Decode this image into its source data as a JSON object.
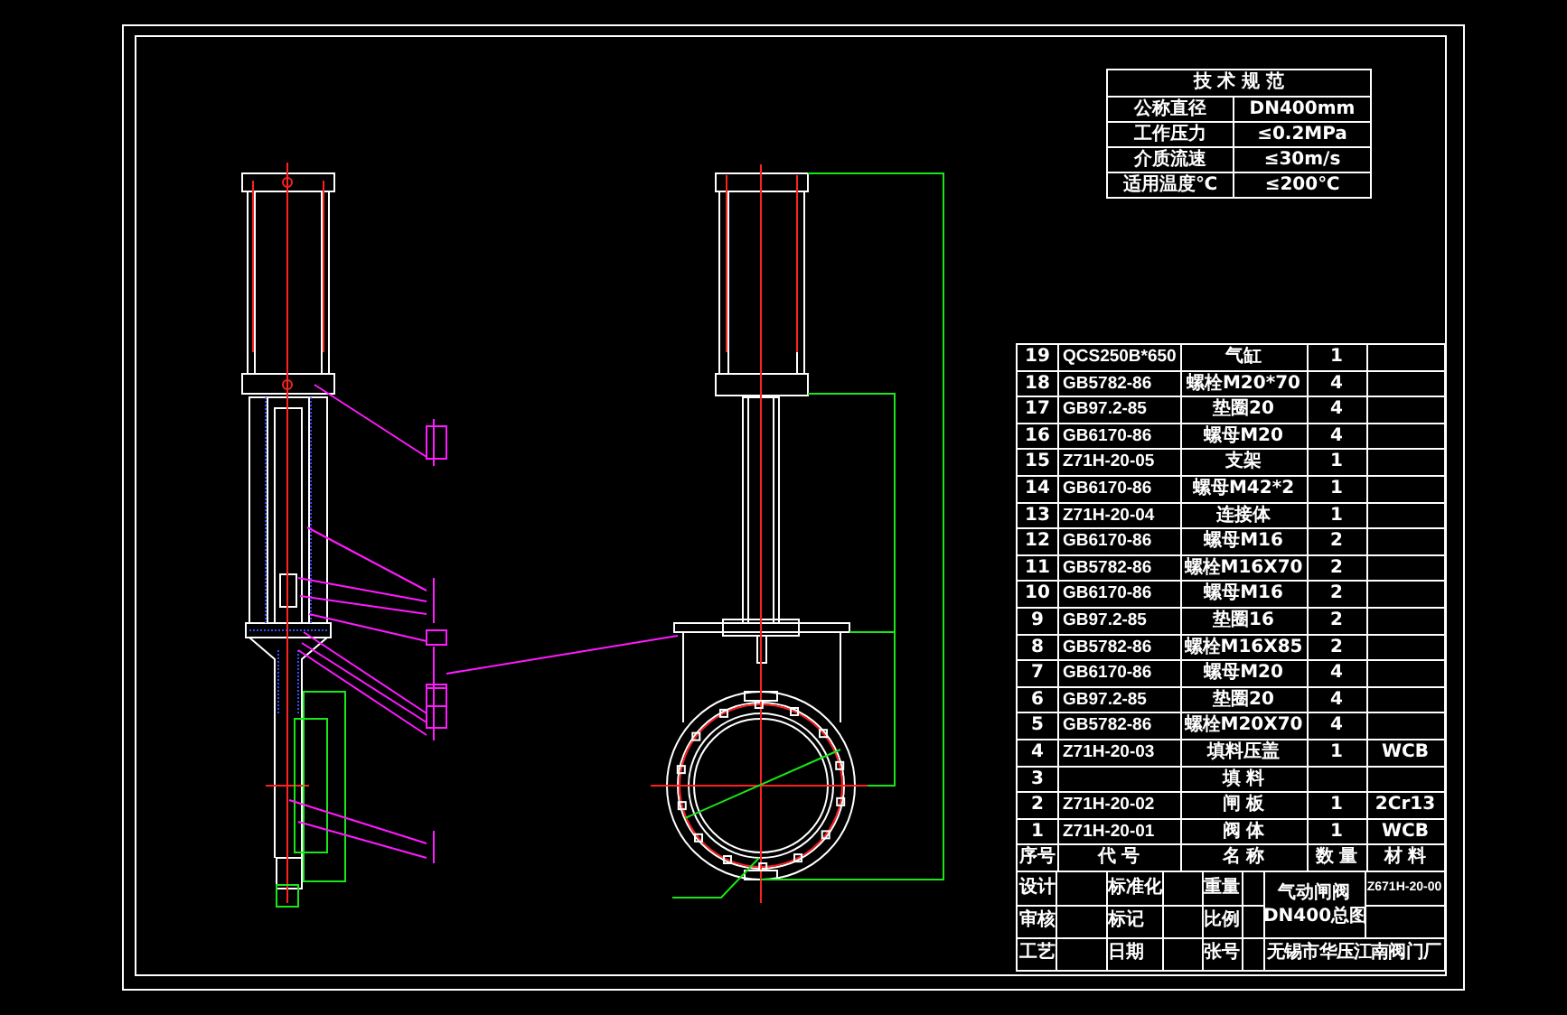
{
  "spec_table": {
    "title": "技 术 规 范",
    "rows": [
      {
        "label": "公称直径",
        "value": "DN400mm"
      },
      {
        "label": "工作压力",
        "value": "≤0.2MPa"
      },
      {
        "label": "介质流速",
        "value": "≤30m/s"
      },
      {
        "label": "适用温度℃",
        "value": "≤200℃"
      }
    ]
  },
  "parts_table": {
    "rows": [
      {
        "no": "19",
        "code": "QCS250B*650",
        "name": "气缸",
        "qty": "1",
        "material": ""
      },
      {
        "no": "18",
        "code": "GB5782-86",
        "name": "螺栓M20*70",
        "qty": "4",
        "material": ""
      },
      {
        "no": "17",
        "code": "GB97.2-85",
        "name": "垫圈20",
        "qty": "4",
        "material": ""
      },
      {
        "no": "16",
        "code": "GB6170-86",
        "name": "螺母M20",
        "qty": "4",
        "material": ""
      },
      {
        "no": "15",
        "code": "Z71H-20-05",
        "name": "支架",
        "qty": "1",
        "material": ""
      },
      {
        "no": "14",
        "code": "GB6170-86",
        "name": "螺母M42*2",
        "qty": "1",
        "material": ""
      },
      {
        "no": "13",
        "code": "Z71H-20-04",
        "name": "连接体",
        "qty": "1",
        "material": ""
      },
      {
        "no": "12",
        "code": "GB6170-86",
        "name": "螺母M16",
        "qty": "2",
        "material": ""
      },
      {
        "no": "11",
        "code": "GB5782-86",
        "name": "螺栓M16X70",
        "qty": "2",
        "material": ""
      },
      {
        "no": "10",
        "code": "GB6170-86",
        "name": "螺母M16",
        "qty": "2",
        "material": ""
      },
      {
        "no": "9",
        "code": "GB97.2-85",
        "name": "垫圈16",
        "qty": "2",
        "material": ""
      },
      {
        "no": "8",
        "code": "GB5782-86",
        "name": "螺栓M16X85",
        "qty": "2",
        "material": ""
      },
      {
        "no": "7",
        "code": "GB6170-86",
        "name": "螺母M20",
        "qty": "4",
        "material": ""
      },
      {
        "no": "6",
        "code": "GB97.2-85",
        "name": "垫圈20",
        "qty": "4",
        "material": ""
      },
      {
        "no": "5",
        "code": "GB5782-86",
        "name": "螺栓M20X70",
        "qty": "4",
        "material": ""
      },
      {
        "no": "4",
        "code": "Z71H-20-03",
        "name": "填料压盖",
        "qty": "1",
        "material": "WCB"
      },
      {
        "no": "3",
        "code": "",
        "name": "填 料",
        "qty": "",
        "material": ""
      },
      {
        "no": "2",
        "code": "Z71H-20-02",
        "name": "闸 板",
        "qty": "1",
        "material": "2Cr13"
      },
      {
        "no": "1",
        "code": "Z71H-20-01",
        "name": "阀 体",
        "qty": "1",
        "material": "WCB"
      }
    ],
    "header": [
      "序号",
      "代 号",
      "名 称",
      "数 量",
      "材 料"
    ]
  },
  "title_block": {
    "labels_1": [
      "设计",
      "审核",
      "工艺"
    ],
    "labels_2": [
      "标准化",
      "标记",
      "日期"
    ],
    "labels_3": [
      "重量",
      "比例",
      "张号"
    ],
    "product": "气动闸阀",
    "drawing": "DN400总图",
    "drawing_number": "Z671H-20-00",
    "company": "无锡市华压江南阀门厂"
  }
}
